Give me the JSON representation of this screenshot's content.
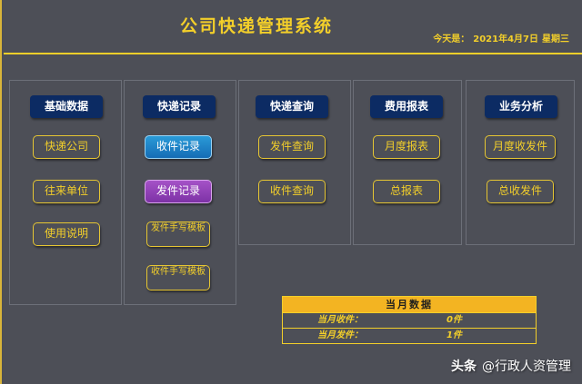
{
  "app": {
    "title": "公司快递管理系统",
    "date_prefix": "今天是：",
    "date": "2021年4月7日",
    "weekday": "星期三"
  },
  "panels": [
    {
      "header": "基础数据",
      "buttons": [
        "快递公司",
        "往来单位",
        "使用说明"
      ]
    },
    {
      "header": "快递记录",
      "buttons": [
        "收件记录",
        "发件记录",
        "发件手写模板",
        "收件手写模板"
      ]
    },
    {
      "header": "快递查询",
      "buttons": [
        "发件查询",
        "收件查询"
      ]
    },
    {
      "header": "费用报表",
      "buttons": [
        "月度报表",
        "总报表"
      ]
    },
    {
      "header": "业务分析",
      "buttons": [
        "月度收发件",
        "总收发件"
      ]
    }
  ],
  "summary": {
    "title": "当月数据",
    "rows": [
      {
        "label": "当月收件：",
        "value": "0件"
      },
      {
        "label": "当月发件：",
        "value": "1件"
      }
    ]
  },
  "watermark": {
    "brand": "头条",
    "handle": "@行政人资管理"
  },
  "colors": {
    "background": "#4d4f57",
    "accent": "#f3cf2a",
    "header_bg": "#0c2b63",
    "blue_button": "#1f86c8",
    "purple_button": "#8f3fb8",
    "summary_header": "#f3b422"
  }
}
